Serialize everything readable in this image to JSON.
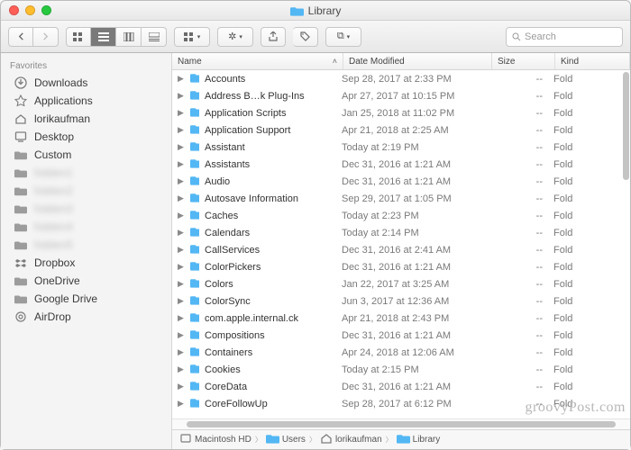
{
  "window": {
    "title": "Library"
  },
  "toolbar": {
    "search_placeholder": "Search"
  },
  "sidebar": {
    "section": "Favorites",
    "items": [
      {
        "icon": "download",
        "label": "Downloads",
        "blurred": false
      },
      {
        "icon": "apps",
        "label": "Applications",
        "blurred": false
      },
      {
        "icon": "home",
        "label": "lorikaufman",
        "blurred": false
      },
      {
        "icon": "desktop",
        "label": "Desktop",
        "blurred": false
      },
      {
        "icon": "folder",
        "label": "Custom",
        "blurred": false
      },
      {
        "icon": "folder",
        "label": "hidden1",
        "blurred": true
      },
      {
        "icon": "folder",
        "label": "hidden2",
        "blurred": true
      },
      {
        "icon": "folder",
        "label": "hidden3",
        "blurred": true
      },
      {
        "icon": "folder",
        "label": "hidden4",
        "blurred": true
      },
      {
        "icon": "folder",
        "label": "hidden5",
        "blurred": true
      },
      {
        "icon": "dropbox",
        "label": "Dropbox",
        "blurred": false
      },
      {
        "icon": "folder",
        "label": "OneDrive",
        "blurred": false
      },
      {
        "icon": "folder",
        "label": "Google Drive",
        "blurred": false
      },
      {
        "icon": "airdrop",
        "label": "AirDrop",
        "blurred": false
      }
    ]
  },
  "columns": {
    "name": "Name",
    "date": "Date Modified",
    "size": "Size",
    "kind": "Kind"
  },
  "rows": [
    {
      "name": "Accounts",
      "date": "Sep 28, 2017 at 2:33 PM",
      "size": "--",
      "kind": "Fold"
    },
    {
      "name": "Address B…k Plug-Ins",
      "date": "Apr 27, 2017 at 10:15 PM",
      "size": "--",
      "kind": "Fold"
    },
    {
      "name": "Application Scripts",
      "date": "Jan 25, 2018 at 11:02 PM",
      "size": "--",
      "kind": "Fold"
    },
    {
      "name": "Application Support",
      "date": "Apr 21, 2018 at 2:25 AM",
      "size": "--",
      "kind": "Fold"
    },
    {
      "name": "Assistant",
      "date": "Today at 2:19 PM",
      "size": "--",
      "kind": "Fold"
    },
    {
      "name": "Assistants",
      "date": "Dec 31, 2016 at 1:21 AM",
      "size": "--",
      "kind": "Fold"
    },
    {
      "name": "Audio",
      "date": "Dec 31, 2016 at 1:21 AM",
      "size": "--",
      "kind": "Fold"
    },
    {
      "name": "Autosave Information",
      "date": "Sep 29, 2017 at 1:05 PM",
      "size": "--",
      "kind": "Fold"
    },
    {
      "name": "Caches",
      "date": "Today at 2:23 PM",
      "size": "--",
      "kind": "Fold"
    },
    {
      "name": "Calendars",
      "date": "Today at 2:14 PM",
      "size": "--",
      "kind": "Fold"
    },
    {
      "name": "CallServices",
      "date": "Dec 31, 2016 at 2:41 AM",
      "size": "--",
      "kind": "Fold"
    },
    {
      "name": "ColorPickers",
      "date": "Dec 31, 2016 at 1:21 AM",
      "size": "--",
      "kind": "Fold"
    },
    {
      "name": "Colors",
      "date": "Jan 22, 2017 at 3:25 AM",
      "size": "--",
      "kind": "Fold"
    },
    {
      "name": "ColorSync",
      "date": "Jun 3, 2017 at 12:36 AM",
      "size": "--",
      "kind": "Fold"
    },
    {
      "name": "com.apple.internal.ck",
      "date": "Apr 21, 2018 at 2:43 PM",
      "size": "--",
      "kind": "Fold"
    },
    {
      "name": "Compositions",
      "date": "Dec 31, 2016 at 1:21 AM",
      "size": "--",
      "kind": "Fold"
    },
    {
      "name": "Containers",
      "date": "Apr 24, 2018 at 12:06 AM",
      "size": "--",
      "kind": "Fold"
    },
    {
      "name": "Cookies",
      "date": "Today at 2:15 PM",
      "size": "--",
      "kind": "Fold"
    },
    {
      "name": "CoreData",
      "date": "Dec 31, 2016 at 1:21 AM",
      "size": "--",
      "kind": "Fold"
    },
    {
      "name": "CoreFollowUp",
      "date": "Sep 28, 2017 at 6:12 PM",
      "size": "--",
      "kind": "Fold"
    }
  ],
  "path": [
    {
      "icon": "disk",
      "label": "Macintosh HD"
    },
    {
      "icon": "folder",
      "label": "Users"
    },
    {
      "icon": "home",
      "label": "lorikaufman"
    },
    {
      "icon": "folder",
      "label": "Library"
    }
  ],
  "watermark": "groovyPost.com"
}
